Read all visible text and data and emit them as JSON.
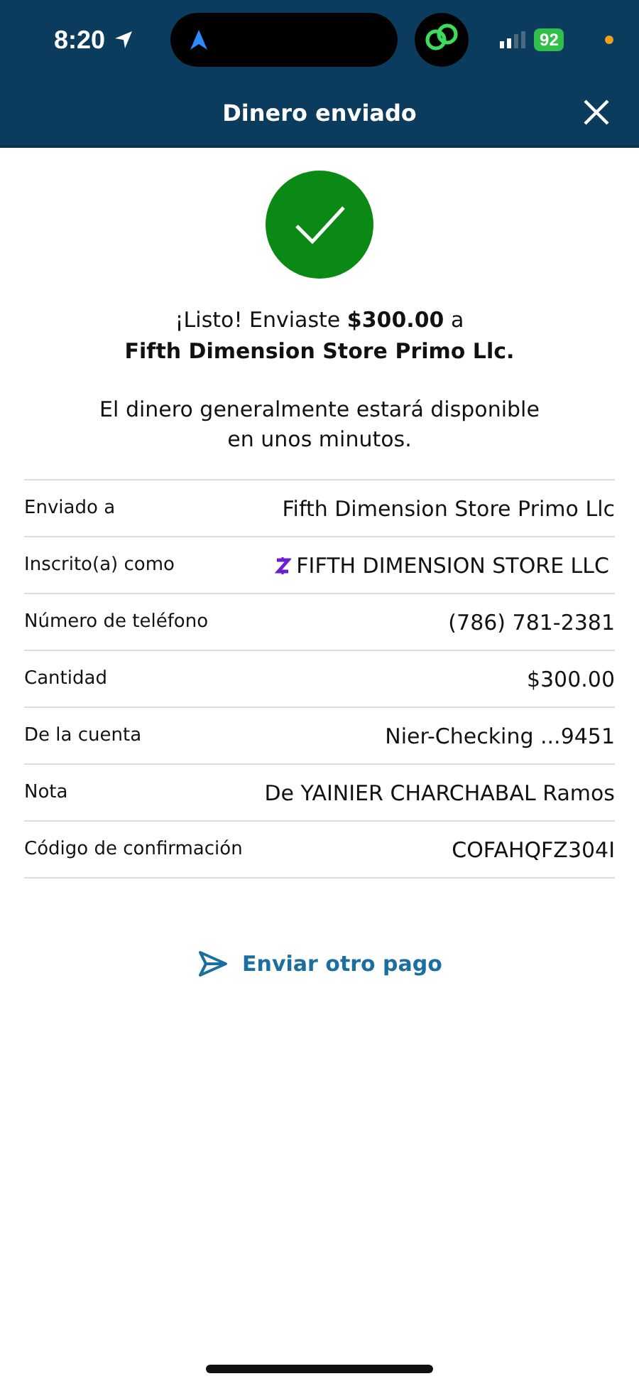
{
  "status_bar": {
    "time": "8:20",
    "battery": "92"
  },
  "header": {
    "title": "Dinero enviado"
  },
  "confirmation": {
    "message": "¡Listo! Enviaste **$300.00** a",
    "recipient": "Fifth Dimension Store Primo Llc.",
    "note": "El dinero generalmente estará disponible en unos minutos."
  },
  "details": [
    {
      "kind": "plain",
      "label": "Enviado a",
      "value": "Fifth Dimension Store Primo Llc"
    },
    {
      "kind": "enrolled",
      "label": "Inscrito(a) como",
      "value": "FIFTH DIMENSION STORE LLC"
    },
    {
      "kind": "plain",
      "label": "Número de teléfono",
      "value": "(786) 781-2381"
    },
    {
      "kind": "plain",
      "label": "Cantidad",
      "value": "$300.00"
    },
    {
      "kind": "plain",
      "label": "De la cuenta",
      "value": "Nier-Checking ...9451"
    },
    {
      "kind": "plain",
      "label": "Nota",
      "value": "De YAINIER CHARCHABAL Ramos"
    },
    {
      "kind": "plain",
      "label": "Código de confirmación",
      "value": "COFAHQFZ304I"
    }
  ],
  "action": {
    "label": "Enviar otro pago"
  }
}
